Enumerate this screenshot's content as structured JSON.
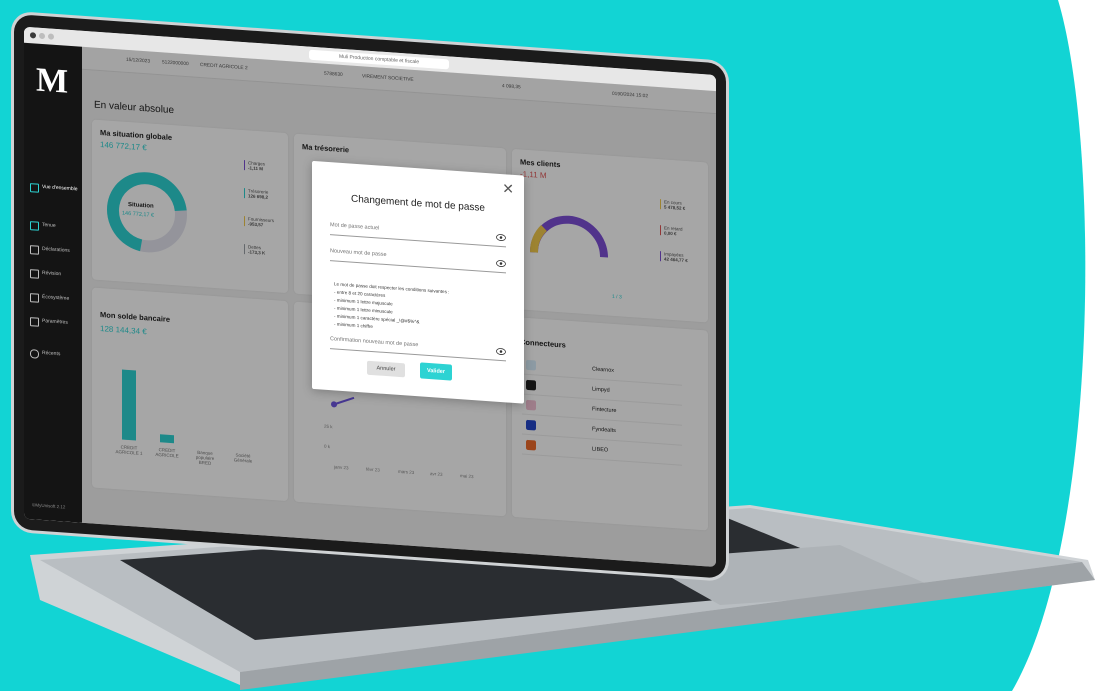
{
  "colors": {
    "accent": "#2dd3d3",
    "background": "#12d4d4",
    "sidebar": "#141414",
    "purple": "#7d4fd6",
    "red": "#e05555",
    "yellow": "#f2c94c"
  },
  "browser": {
    "url_text": "Muli Production comptable et fiscale"
  },
  "sidebar": {
    "logo": "M",
    "items": [
      {
        "label": "Vue d'ensemble",
        "icon": "grid-icon",
        "active": true
      },
      {
        "label": "Tenue",
        "icon": "columns-icon"
      },
      {
        "label": "Déclarations",
        "icon": "file-icon"
      },
      {
        "label": "Révision",
        "icon": "list-icon"
      },
      {
        "label": "Écosystème",
        "icon": "cart-icon"
      },
      {
        "label": "Paramètres",
        "icon": "sliders-icon"
      },
      {
        "label": "Récents",
        "icon": "undo-icon"
      }
    ],
    "copyright": "©MyUnisoft 2.12"
  },
  "toprow": {
    "date": "15/12/2023",
    "code": "5122000000",
    "bank": "CREDIT AGRICOLE 2",
    "ref": "5788630",
    "label": "VIREMENT SOCIETIVE",
    "amount": "4 098,35",
    "extra": "0190/2024 15:02"
  },
  "main": {
    "section_title": "En valeur absolue",
    "cards": {
      "situation": {
        "title": "Ma situation globale",
        "value": "146 772,17 €",
        "center_label": "Situation",
        "center_value": "146 772,17 €",
        "legend": [
          {
            "label": "Charges",
            "value": "-1,11 M"
          },
          {
            "label": "Trésorerie",
            "value": "126 698,2"
          },
          {
            "label": "Fournisseurs",
            "value": "-953,57"
          },
          {
            "label": "Dettes",
            "value": "-173,3 K"
          }
        ]
      },
      "tresorerie": {
        "title": "Ma trésorerie"
      },
      "clients": {
        "title": "Mes clients",
        "value": "-1,11 M",
        "legend": [
          {
            "label": "En cours",
            "value": "5 478,52 €"
          },
          {
            "label": "En retard",
            "value": "0,00 €"
          },
          {
            "label": "Impayées",
            "value": "42 464,77 €"
          }
        ],
        "pager": "1 / 3"
      },
      "solde": {
        "title": "Mon solde bancaire",
        "value": "128 144,34 €",
        "categories": [
          "CREDIT AGRICOLE 1",
          "CREDIT AGRICOLE",
          "Banque populaire BRED",
          "Société Générale"
        ]
      },
      "chart_mid": {
        "ticks_y": [
          "25 k",
          "0 k"
        ],
        "ticks_x": [
          "janv 23",
          "févr 23",
          "mars 23",
          "avr 23",
          "mai 23"
        ]
      },
      "connecteurs": {
        "title": "Connecteurs",
        "items": [
          "Clearnox",
          "Limpyd",
          "Fintecture",
          "Fyndealts",
          "LIBEO"
        ]
      }
    }
  },
  "modal": {
    "title": "Changement de mot de passe",
    "current_placeholder": "Mot de passe actuel",
    "new_placeholder": "Nouveau mot de passe",
    "confirm_placeholder": "Confirmation nouveau mot de passe",
    "rules_intro": "Le mot de passe doit respecter les conditions suivantes :",
    "rules": [
      "- entre 8 et 20 caractères",
      "- minimum 1 lettre majuscule",
      "- minimum 1 lettre minuscule",
      "- minimum 1 caractère spécial _!@#$%^&",
      "- minimum 1 chiffre"
    ],
    "cancel_label": "Annuler",
    "submit_label": "Valider"
  }
}
